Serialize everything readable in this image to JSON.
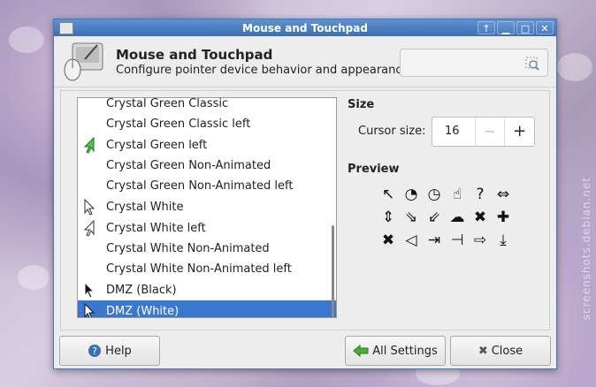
{
  "window": {
    "title": "Mouse and Touchpad"
  },
  "titlebar": {
    "buttons": [
      "up-arrow",
      "minimize",
      "maximize",
      "close"
    ]
  },
  "header": {
    "title": "Mouse and Touchpad",
    "subtitle": "Configure pointer device behavior and appearance",
    "search_value": ""
  },
  "theme_list": {
    "items": [
      {
        "label": "Crystal Green Classic",
        "icon": "none"
      },
      {
        "label": "Crystal Green Classic left",
        "icon": "none"
      },
      {
        "label": "Crystal Green left",
        "icon": "green-arrow-left"
      },
      {
        "label": "Crystal Green Non-Animated",
        "icon": "none"
      },
      {
        "label": "Crystal Green Non-Animated left",
        "icon": "none"
      },
      {
        "label": "Crystal White",
        "icon": "white-arrow"
      },
      {
        "label": "Crystal White left",
        "icon": "white-arrow-left"
      },
      {
        "label": "Crystal White Non-Animated",
        "icon": "none"
      },
      {
        "label": "Crystal White Non-Animated left",
        "icon": "none"
      },
      {
        "label": "DMZ (Black)",
        "icon": "black-arrow"
      },
      {
        "label": "DMZ (White)",
        "icon": "white-arrow",
        "selected": true
      }
    ]
  },
  "size": {
    "heading": "Size",
    "label": "Cursor size:",
    "value": "16",
    "minus": "−",
    "plus": "+"
  },
  "preview": {
    "heading": "Preview",
    "cursors": [
      "↖",
      "◔",
      "◷",
      "☝",
      "?",
      "⇔",
      "⇕",
      "⇘",
      "⇙",
      "☁",
      "✖",
      "✚",
      "✖",
      "◁",
      "⇥",
      "⊣",
      "⇨",
      "⤓"
    ]
  },
  "footer": {
    "help": "Help",
    "all_settings": "All Settings",
    "close": "Close"
  },
  "desktop": {
    "watermark": "screenshots.debian.net"
  }
}
